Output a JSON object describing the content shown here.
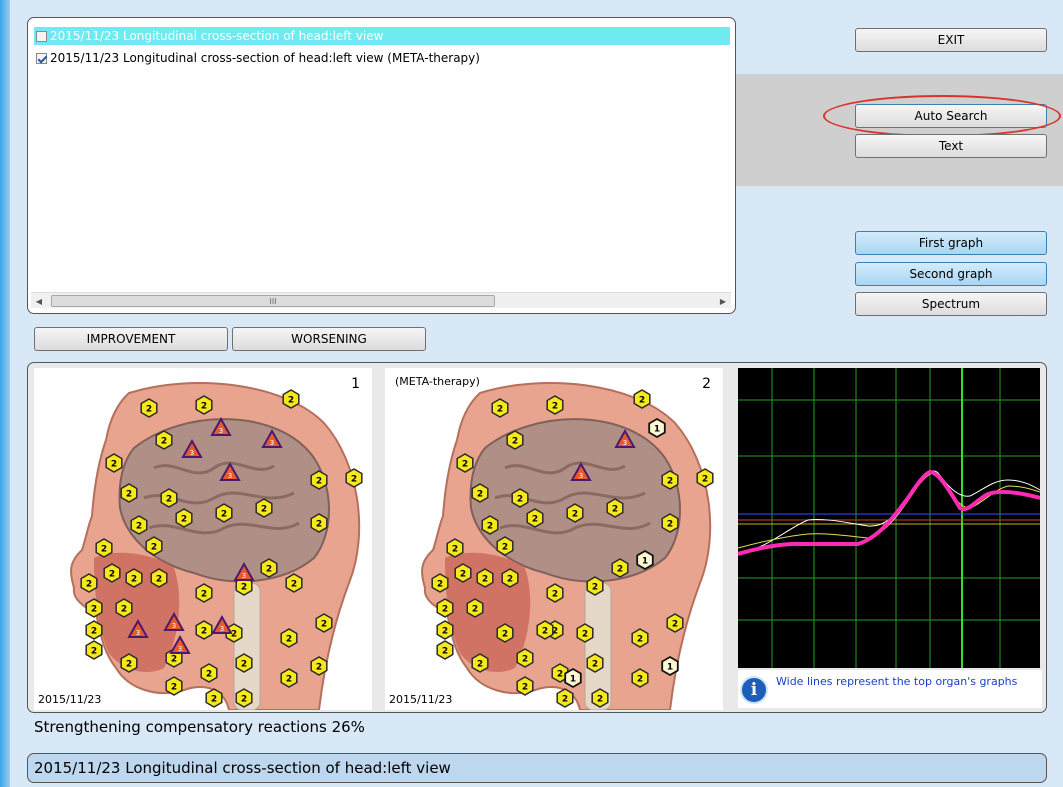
{
  "session_list": {
    "items": [
      {
        "label": "2015/11/23  Longitudinal cross-section of head:left view",
        "checked": false,
        "selected": true
      },
      {
        "label": "2015/11/23  Longitudinal cross-section of head:left view  (META-therapy)",
        "checked": true,
        "selected": false
      }
    ]
  },
  "buttons": {
    "exit": "EXIT",
    "auto_search": "Auto Search",
    "text": "Text",
    "first_graph": "First graph",
    "second_graph": "Second graph",
    "spectrum": "Spectrum",
    "improvement": "IMPROVEMENT",
    "worsening": "WORSENING"
  },
  "views": [
    {
      "number": "1",
      "title": "",
      "date": "2015/11/23"
    },
    {
      "number": "2",
      "title": "(META-therapy)",
      "date": "2015/11/23"
    }
  ],
  "marker_icon": "hexagon-marker-icon",
  "graph_note": "Wide lines represent the top organ's graphs",
  "status": "Strengthening compensatory reactions 26%",
  "bottom_bar": "2015/11/23 Longitudinal cross-section of head:left view",
  "colors": {
    "selection": "#6eeaf0",
    "graph_grid": "#1fa01f",
    "graph_main": "#ff2ab4",
    "highlight_ring": "#d9342b"
  }
}
